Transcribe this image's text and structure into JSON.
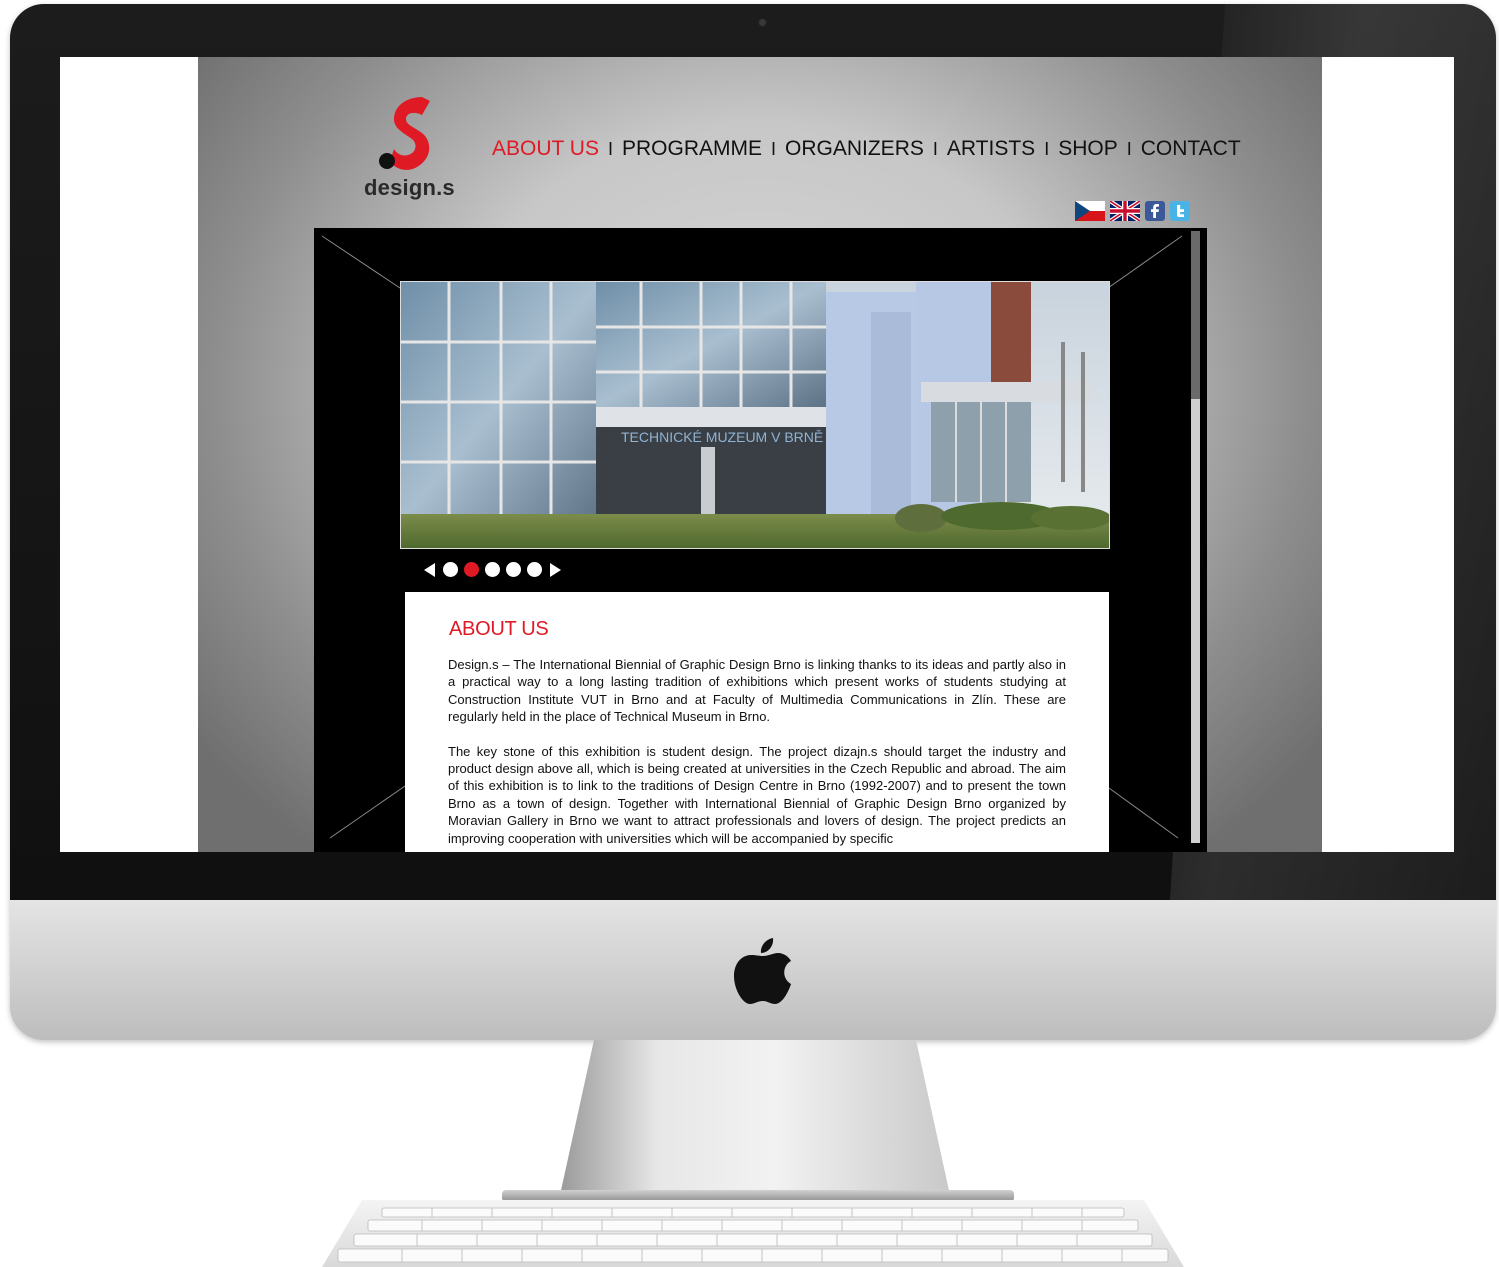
{
  "site": {
    "logo_text": "design.s",
    "nav": [
      {
        "label": "ABOUT US",
        "active": true
      },
      {
        "label": "PROGRAMME",
        "active": false
      },
      {
        "label": "ORGANIZERS",
        "active": false
      },
      {
        "label": "ARTISTS",
        "active": false
      },
      {
        "label": "SHOP",
        "active": false
      },
      {
        "label": "CONTACT",
        "active": false
      }
    ],
    "nav_separator": "I",
    "icons": [
      "czech-flag-icon",
      "uk-flag-icon",
      "facebook-icon",
      "twitter-icon"
    ],
    "slider": {
      "photo_sign": "TECHNICKÉ MUZEUM V BRNĚ",
      "dots": 5,
      "active_dot_index": 1
    },
    "about": {
      "title": "ABOUT US",
      "paragraphs": [
        "Design.s – The International Biennial of Graphic Design Brno is linking thanks to its ideas and partly also in a practical way to a long lasting tradition of exhibitions which present works of students studying at Construction Institute VUT in Brno and at Faculty of Multimedia Communications in Zlín. These are regularly held in the place of Technical Museum in Brno.",
        "The key stone of this exhibition is student design. The project dizajn.s should target the industry and product design above all, which is being created at universities in the Czech Republic and abroad. The aim of this exhibition is to link to the traditions of Design Centre in Brno (1992-2007) and to present the town Brno as a town of design. Together with International Biennial of Graphic Design Brno organized by Moravian Gallery in Brno we want to attract professionals and lovers of design. The project predicts an improving cooperation with universities which will be accompanied by specific"
      ]
    },
    "colors": {
      "accent": "#e01a25",
      "stage_bg": "#000000",
      "page_gray": "#c7c7c7"
    }
  }
}
